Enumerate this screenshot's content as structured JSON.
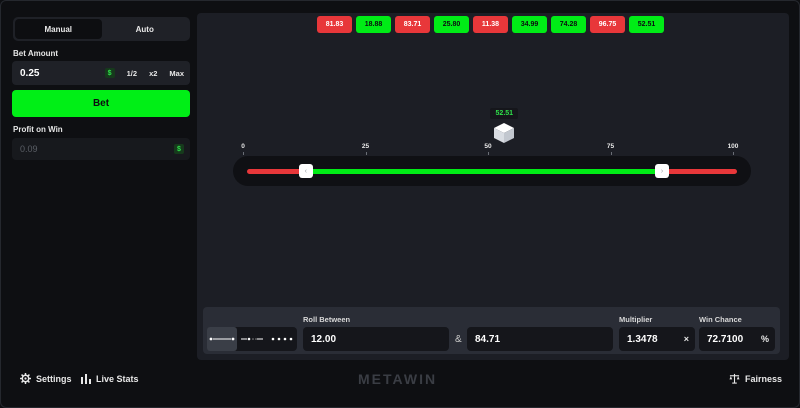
{
  "sidebar": {
    "tabs": [
      {
        "label": "Manual",
        "active": true
      },
      {
        "label": "Auto",
        "active": false
      }
    ],
    "bet_amount": {
      "label": "Bet Amount",
      "value": "0.25",
      "currency_icon": "$",
      "half": "1/2",
      "double": "x2",
      "max": "Max"
    },
    "bet_button": "Bet",
    "profit": {
      "label": "Profit on Win",
      "value": "0.09",
      "currency_icon": "$"
    }
  },
  "history": [
    {
      "value": "81.83",
      "status": "red"
    },
    {
      "value": "18.88",
      "status": "green"
    },
    {
      "value": "83.71",
      "status": "red"
    },
    {
      "value": "25.80",
      "status": "green"
    },
    {
      "value": "11.38",
      "status": "red"
    },
    {
      "value": "34.99",
      "status": "green"
    },
    {
      "value": "74.28",
      "status": "green"
    },
    {
      "value": "96.75",
      "status": "red"
    },
    {
      "value": "52.51",
      "status": "green"
    }
  ],
  "slider": {
    "ticks": [
      "0",
      "25",
      "50",
      "75",
      "100"
    ],
    "min": 0,
    "max": 100,
    "low": 12.0,
    "high": 84.71,
    "result": "52.51",
    "result_value": 52.51
  },
  "controls": {
    "roll_label": "Roll Between",
    "roll_low": "12.00",
    "and_symbol": "&",
    "roll_high": "84.71",
    "multiplier_label": "Multiplier",
    "multiplier": "1.3478",
    "multiplier_suffix": "×",
    "win_chance_label": "Win Chance",
    "win_chance": "72.7100",
    "win_chance_suffix": "%"
  },
  "footer": {
    "settings": "Settings",
    "live_stats": "Live Stats",
    "logo": "METAWIN",
    "fairness": "Fairness"
  },
  "colors": {
    "win": "#00ec16",
    "loss": "#e8373a",
    "accent": "#00ef16"
  }
}
